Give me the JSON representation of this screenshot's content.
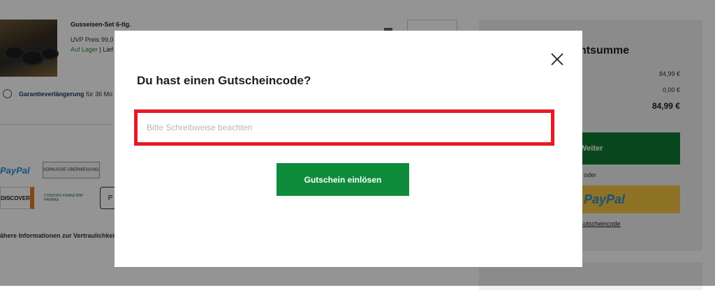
{
  "cart": {
    "product_title": "Gusseisen-Set 6-tlg.",
    "uvp_label": "UVP Preis",
    "uvp_value": "99,0",
    "stock_label": "Auf Lager",
    "delivery_prefix": "| Lief",
    "guarantee_label": "Garantieverlängerung",
    "guarantee_suffix": "für 36 Mo",
    "privacy_text": "ähere Informationen zur Vertraulichkei",
    "payment_methods": {
      "paypal": "PayPal",
      "vorkasse": "VORKASSE ÜBERWEISUNG",
      "discover": "DISCOVER",
      "consors": "CONSORS FINANZ BNP PARIBAS",
      "applepay": "P"
    }
  },
  "summary": {
    "title": "ntsumme",
    "line1_value": "84,99 €",
    "line2_value": "0,00 €",
    "total_value": "84,99 €",
    "continue_label": "Weiter",
    "or_label": "oder",
    "paypal_label": "PayPal",
    "coupon_link": "en Gutscheincode"
  },
  "modal": {
    "title": "Du hast einen Gutscheincode?",
    "input_placeholder": "Bitte Schreibweise beachten",
    "input_value": "",
    "redeem_label": "Gutschein einlösen",
    "close_icon": "close-icon"
  },
  "colors": {
    "primary_green": "#0e8c3c",
    "highlight_red": "#e51b24",
    "paypal_yellow": "#f4c542",
    "overlay": "rgba(0,0,0,0.42)"
  }
}
